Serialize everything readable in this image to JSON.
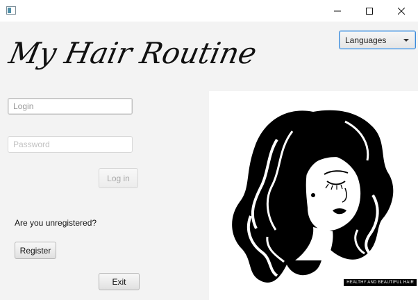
{
  "window": {
    "title": "",
    "icon": "app-window-icon",
    "controls": [
      "minimize-icon",
      "maximize-icon",
      "close-icon"
    ]
  },
  "header": {
    "title": "My Hair Routine",
    "language_select": {
      "selected": "Languages",
      "icon": "chevron-down-icon"
    }
  },
  "form": {
    "login_placeholder": "Login",
    "login_value": "",
    "password_placeholder": "Password",
    "password_value": "",
    "login_button": "Log in",
    "unregistered_text": "Are you unregistered?",
    "register_button": "Register",
    "exit_button": "Exit"
  },
  "hero": {
    "caption": "HEALTHY AND BEAUTIFUL HAIR",
    "image": "woman-with-long-wavy-hair-illustration"
  },
  "colors": {
    "window_bg": "#f3f3f3",
    "focus_border": "#3c8ad8",
    "hair": "#000000"
  }
}
